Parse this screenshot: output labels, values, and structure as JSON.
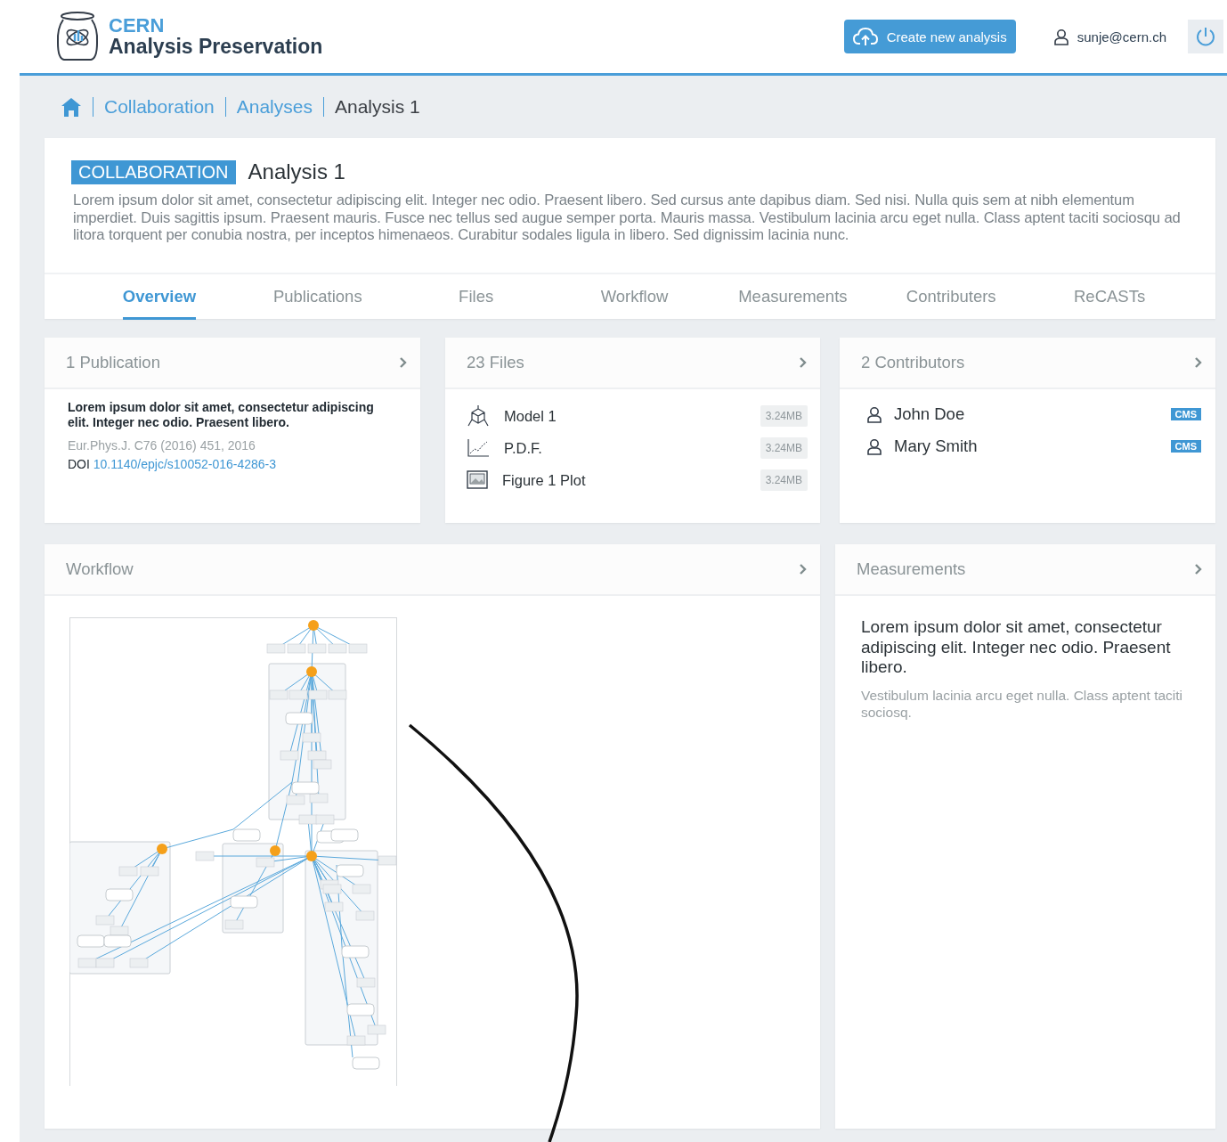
{
  "header": {
    "logo_title": "CERN",
    "logo_subtitle": "Analysis Preservation",
    "create_button": "Create new analysis",
    "user": "sunje@cern.ch"
  },
  "breadcrumb": [
    {
      "label": "Collaboration",
      "link": true
    },
    {
      "label": "Analyses",
      "link": true
    },
    {
      "label": "Analysis 1",
      "link": false
    }
  ],
  "analysis": {
    "badge": "COLLABORATION",
    "title": "Analysis 1",
    "description": "Lorem ipsum dolor sit amet, consectetur adipiscing elit. Integer nec odio. Praesent libero. Sed cursus ante dapibus diam. Sed nisi. Nulla quis sem at nibh elementum imperdiet. Duis sagittis ipsum. Praesent mauris. Fusce nec tellus sed augue semper porta. Mauris massa. Vestibulum lacinia arcu eget nulla. Class aptent taciti sociosqu ad litora torquent per conubia nostra, per inceptos himenaeos. Curabitur sodales ligula in libero. Sed dignissim lacinia nunc."
  },
  "tabs": [
    {
      "label": "Overview",
      "selected": true
    },
    {
      "label": "Publications",
      "selected": false
    },
    {
      "label": "Files",
      "selected": false
    },
    {
      "label": "Workflow",
      "selected": false
    },
    {
      "label": "Measurements",
      "selected": false
    },
    {
      "label": "Contributers",
      "selected": false
    },
    {
      "label": "ReCASTs",
      "selected": false
    }
  ],
  "publications": {
    "title": "1 Publication",
    "text": "Lorem ipsum dolor sit amet, consectetur adipiscing elit. Integer nec odio. Praesent libero.",
    "citation": "Eur.Phys.J. C76 (2016) 451, 2016",
    "doi_label": "DOI",
    "doi": "10.1140/epjc/s10052-016-4286-3"
  },
  "files": {
    "title": "23 Files",
    "items": [
      {
        "kind": "model",
        "name": "Model 1",
        "size": "3.24MB"
      },
      {
        "kind": "plot",
        "name": "P.D.F.",
        "size": "3.24MB"
      },
      {
        "kind": "image",
        "name": "Figure 1 Plot",
        "size": "3.24MB"
      }
    ]
  },
  "contributors": {
    "title": "2 Contributors",
    "items": [
      {
        "name": "John Doe",
        "badge": "CMS"
      },
      {
        "name": "Mary Smith",
        "badge": "CMS"
      }
    ]
  },
  "workflow": {
    "title": "Workflow"
  },
  "measurements": {
    "title": "Measurements",
    "lead": "Lorem ipsum dolor sit amet, consectetur adipiscing elit. Integer nec odio. Praesent libero.",
    "text": "Vestibulum lacinia arcu eget nulla. Class aptent taciti sociosq."
  }
}
